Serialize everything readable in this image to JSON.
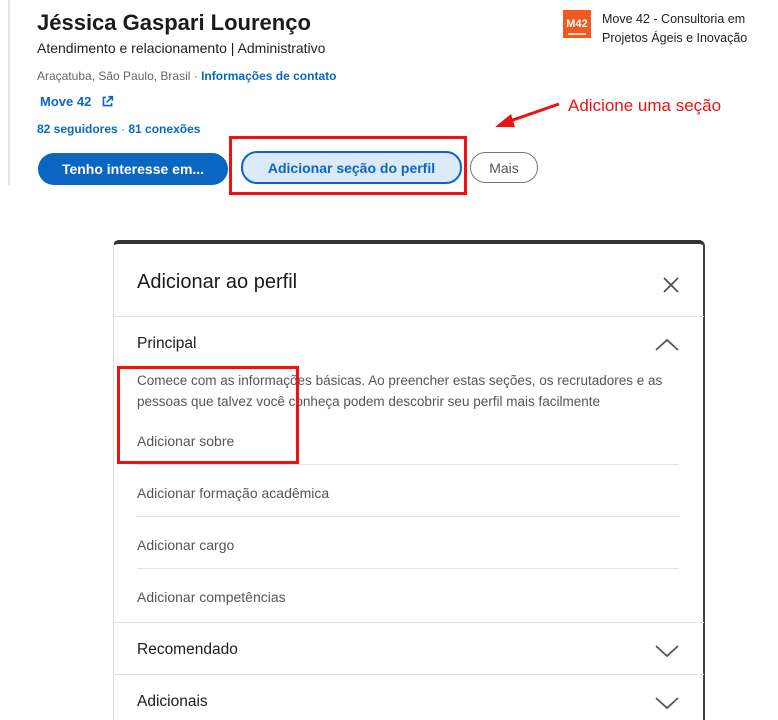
{
  "profile": {
    "name": "Jéssica Gaspari Lourenço",
    "headline": "Atendimento e relacionamento | Administrativo",
    "location": "Araçatuba, São Paulo, Brasil",
    "location_sep": " · ",
    "contact_link": "Informações de contato",
    "company_link": "Move 42",
    "followers": "82 seguidores",
    "counts_sep": " · ",
    "connections": "81 conexões",
    "buttons": {
      "interest": "Tenho interesse em...",
      "add_section": "Adicionar seção do perfil",
      "more": "Mais"
    },
    "company": {
      "logo_text": "M42",
      "name": "Move 42 - Consultoria em Projetos Ágeis e Inovação"
    }
  },
  "annotation": {
    "text": "Adicione uma seção",
    "color": "#ee1111"
  },
  "modal": {
    "title": "Adicionar ao perfil",
    "sections": [
      {
        "title": "Principal",
        "expanded": true,
        "description": "Comece com as informações básicas. Ao preencher estas seções, os recrutadores e as pessoas que talvez você conheça podem descobrir seu perfil mais facilmente",
        "items": [
          "Adicionar sobre",
          "Adicionar formação acadêmica",
          "Adicionar cargo",
          "Adicionar competências"
        ]
      },
      {
        "title": "Recomendado",
        "expanded": false
      },
      {
        "title": "Adicionais",
        "expanded": false
      }
    ]
  },
  "colors": {
    "brand": "#0a66c2",
    "highlight": "#ee1111",
    "logo": "#f15a1e"
  }
}
